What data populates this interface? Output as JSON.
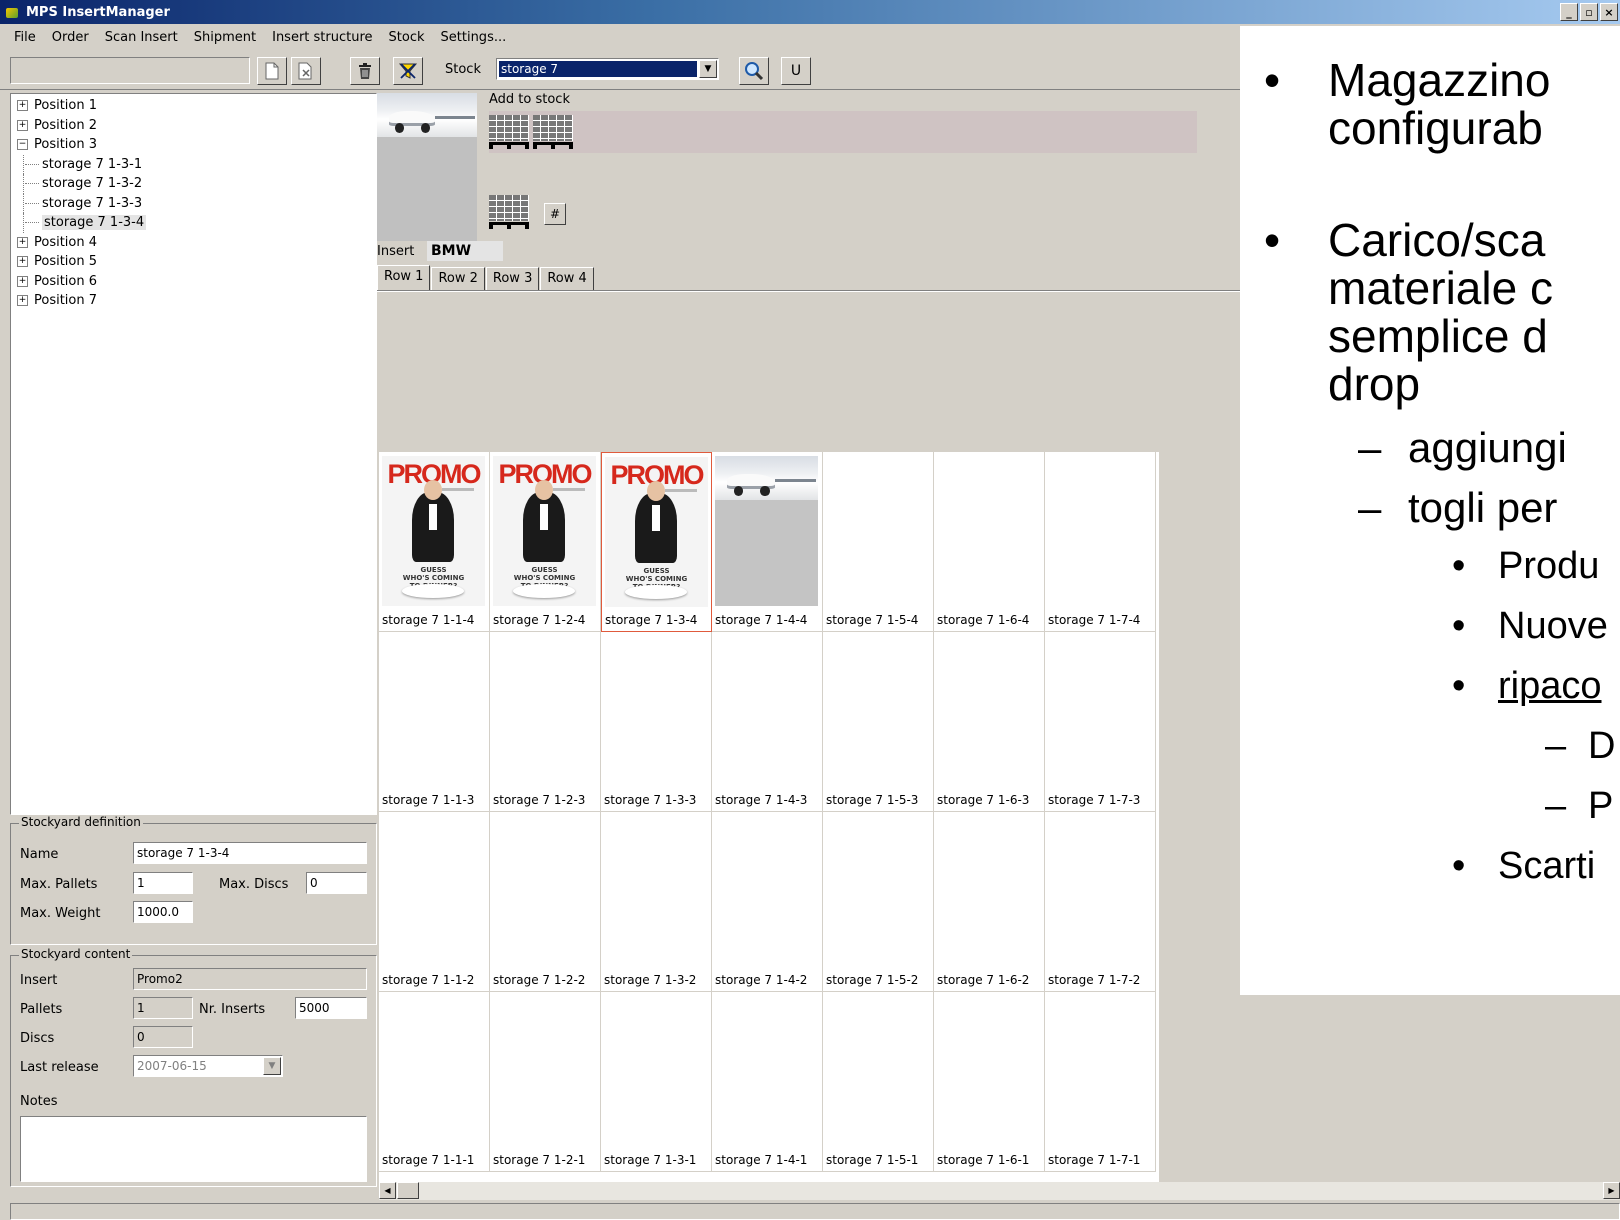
{
  "window": {
    "title": "MPS InsertManager",
    "controls": [
      "_",
      "▫",
      "×"
    ]
  },
  "menu": [
    "File",
    "Order",
    "Scan Insert",
    "Shipment",
    "Insert structure",
    "Stock",
    "Settings..."
  ],
  "toolbar": {
    "stock_label": "Stock",
    "stock_selected": "storage 7",
    "u_label": "U"
  },
  "tree": [
    {
      "label": "Position 1",
      "toggle": "+",
      "child": false
    },
    {
      "label": "Position 2",
      "toggle": "+",
      "child": false
    },
    {
      "label": "Position 3",
      "toggle": "−",
      "child": false
    },
    {
      "label": "storage 7 1-3-1",
      "child": true
    },
    {
      "label": "storage 7 1-3-2",
      "child": true
    },
    {
      "label": "storage 7 1-3-3",
      "child": true
    },
    {
      "label": "storage 7 1-3-4",
      "child": true,
      "selected": true
    },
    {
      "label": "Position 4",
      "toggle": "+",
      "child": false
    },
    {
      "label": "Position 5",
      "toggle": "+",
      "child": false
    },
    {
      "label": "Position 6",
      "toggle": "+",
      "child": false
    },
    {
      "label": "Position 7",
      "toggle": "+",
      "child": false
    }
  ],
  "stockyard_definition": {
    "title": "Stockyard definition",
    "name_label": "Name",
    "name_value": "storage 7 1-3-4",
    "max_pallets_label": "Max. Pallets",
    "max_pallets_value": "1",
    "max_discs_label": "Max. Discs",
    "max_discs_value": "0",
    "max_weight_label": "Max. Weight",
    "max_weight_value": "1000.0"
  },
  "stockyard_content": {
    "title": "Stockyard content",
    "insert_label": "Insert",
    "insert_value": "Promo2",
    "pallets_label": "Pallets",
    "pallets_value": "1",
    "nr_inserts_label": "Nr. Inserts",
    "nr_inserts_value": "5000",
    "discs_label": "Discs",
    "discs_value": "0",
    "last_release_label": "Last release",
    "last_release_value": "2007-06-15",
    "notes_label": "Notes",
    "notes_value": ""
  },
  "add_panel": {
    "add_to_stock": "Add to stock",
    "hash_label": "#",
    "insert_label": "Insert",
    "insert_value": "BMW"
  },
  "tabs": [
    "Row 1",
    "Row 2",
    "Row 3",
    "Row 4"
  ],
  "promo_title": "PROMO",
  "promo_caption": [
    "GUESS",
    "WHO'S COMING",
    "TO DINNER?"
  ],
  "grid_rows": [
    {
      "cells": [
        {
          "label": "storage 7 1-1-4",
          "content": "promo"
        },
        {
          "label": "storage 7 1-2-4",
          "content": "promo"
        },
        {
          "label": "storage 7 1-3-4",
          "content": "promo",
          "selected": true
        },
        {
          "label": "storage 7 1-4-4",
          "content": "car"
        },
        {
          "label": "storage 7 1-5-4",
          "content": ""
        },
        {
          "label": "storage 7 1-6-4",
          "content": ""
        },
        {
          "label": "storage 7 1-7-4",
          "content": ""
        }
      ]
    },
    {
      "cells": [
        {
          "label": "storage 7 1-1-3"
        },
        {
          "label": "storage 7 1-2-3"
        },
        {
          "label": "storage 7 1-3-3"
        },
        {
          "label": "storage 7 1-4-3"
        },
        {
          "label": "storage 7 1-5-3"
        },
        {
          "label": "storage 7 1-6-3"
        },
        {
          "label": "storage 7 1-7-3"
        }
      ]
    },
    {
      "cells": [
        {
          "label": "storage 7 1-1-2"
        },
        {
          "label": "storage 7 1-2-2"
        },
        {
          "label": "storage 7 1-3-2"
        },
        {
          "label": "storage 7 1-4-2"
        },
        {
          "label": "storage 7 1-5-2"
        },
        {
          "label": "storage 7 1-6-2"
        },
        {
          "label": "storage 7 1-7-2"
        }
      ]
    },
    {
      "cells": [
        {
          "label": "storage 7 1-1-1"
        },
        {
          "label": "storage 7 1-2-1"
        },
        {
          "label": "storage 7 1-3-1"
        },
        {
          "label": "storage 7 1-4-1"
        },
        {
          "label": "storage 7 1-5-1"
        },
        {
          "label": "storage 7 1-6-1"
        },
        {
          "label": "storage 7 1-7-1"
        }
      ]
    }
  ],
  "slide": [
    {
      "bullet": "•",
      "text": "Magazzino",
      "level": 1
    },
    {
      "bullet": "",
      "text": "configurab",
      "level": 1
    },
    {
      "bullet": "•",
      "text": "Carico/sca",
      "level": 1
    },
    {
      "bullet": "",
      "text": "materiale c",
      "level": 1
    },
    {
      "bullet": "",
      "text": "semplice d",
      "level": 1
    },
    {
      "bullet": "",
      "text": "drop",
      "level": 1
    },
    {
      "bullet": "–",
      "text": "aggiungi",
      "level": 2
    },
    {
      "bullet": "–",
      "text": "togli per",
      "level": 2
    },
    {
      "bullet": "•",
      "text": "Produ",
      "level": 3
    },
    {
      "bullet": "•",
      "text": "Nuove",
      "level": 3
    },
    {
      "bullet": "•",
      "text": "ripaco",
      "level": 3,
      "underline": true
    },
    {
      "bullet": "–",
      "text": "D",
      "level": 4
    },
    {
      "bullet": "–",
      "text": "P",
      "level": 4
    },
    {
      "bullet": "•",
      "text": "Scarti",
      "level": 3
    }
  ]
}
